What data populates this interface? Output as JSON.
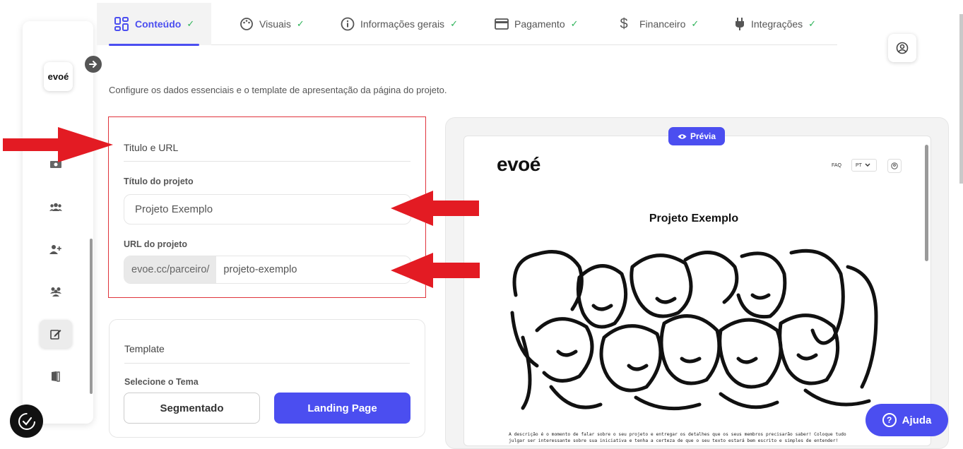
{
  "tabs": [
    {
      "label": "Conteúdo",
      "icon": "grid-icon",
      "active": true
    },
    {
      "label": "Visuais",
      "icon": "palette-icon"
    },
    {
      "label": "Informações gerais",
      "icon": "info-icon"
    },
    {
      "label": "Pagamento",
      "icon": "credit-card-icon"
    },
    {
      "label": "Financeiro",
      "icon": "dollar-icon"
    },
    {
      "label": "Integrações",
      "icon": "plug-icon"
    }
  ],
  "sidebar": {
    "logo": "evoé",
    "items": [
      {
        "icon": "money-icon"
      },
      {
        "icon": "group-icon"
      },
      {
        "icon": "add-user-icon"
      },
      {
        "icon": "team-icon"
      },
      {
        "icon": "edit-icon",
        "active": true
      },
      {
        "icon": "exit-door-icon"
      }
    ]
  },
  "intro_text": "Configure os dados essenciais e o template de apresentação da página do projeto.",
  "title_card": {
    "title": "Titulo e URL",
    "project_title_label": "Título do projeto",
    "project_title_value": "Projeto Exemplo",
    "url_label": "URL do projeto",
    "url_prefix": "evoe.cc/parceiro/",
    "url_value": "projeto-exemplo"
  },
  "template_card": {
    "title": "Template",
    "theme_label": "Selecione o Tema",
    "option_segmented": "Segmentado",
    "option_landing": "Landing Page",
    "selected": "Landing Page"
  },
  "preview": {
    "badge": "Prévia",
    "logo": "evoé",
    "faq": "FAQ",
    "lang": "PT",
    "project_title": "Projeto Exemplo",
    "description_line1": "A descrição é o momento de falar sobre o seu projeto e entregar os detalhes que os seus membros precisarão saber! Coloque tudo",
    "description_line2": "julgar ser interessante sobre sua iniciativa e tenha a certeza de que o seu texto estará bem escrito e simples de entender!"
  },
  "help": {
    "label": "Ajuda"
  },
  "colors": {
    "accent": "#4b4ef0",
    "check": "#2fb45a",
    "highlight_border": "#e0343c",
    "arrow": "#e31b23"
  }
}
